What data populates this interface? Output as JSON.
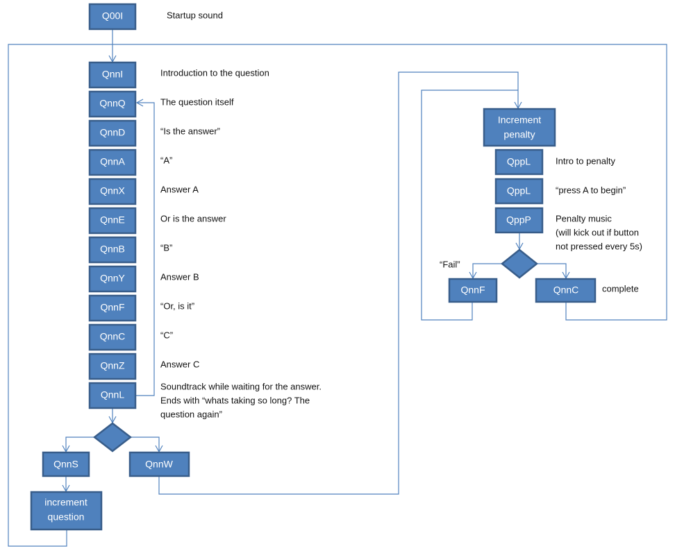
{
  "colors": {
    "node_fill": "#4f81bd",
    "node_border": "#385d8a",
    "connector": "#4f81bd"
  },
  "nodes": {
    "start": {
      "label": "Q00I",
      "note": "Startup sound"
    },
    "questions": [
      {
        "label": "QnnI",
        "note": "Introduction to the question"
      },
      {
        "label": "QnnQ",
        "note": "The question  itself"
      },
      {
        "label": "QnnD",
        "note": "“Is the answer”"
      },
      {
        "label": "QnnA",
        "note": "“A”"
      },
      {
        "label": "QnnX",
        "note": "Answer  A"
      },
      {
        "label": "QnnE",
        "note": "Or is the answer"
      },
      {
        "label": "QnnB",
        "note": "“B”"
      },
      {
        "label": "QnnY",
        "note": "Answer  B"
      },
      {
        "label": "QnnF",
        "note": "“Or, is it”"
      },
      {
        "label": "QnnC",
        "note": "“C”"
      },
      {
        "label": "QnnZ",
        "note": "Answer  C"
      },
      {
        "label": "QnnL",
        "note_lines": [
          "Soundtrack  while waiting for the answer.",
          "Ends with “whats taking so long? The",
          "question again”"
        ]
      }
    ],
    "success": {
      "label": "QnnS"
    },
    "wrong": {
      "label": "QnnW"
    },
    "increment_question": {
      "lines": [
        "increment",
        "question"
      ]
    },
    "increment_penalty": {
      "lines": [
        "Increment",
        "penalty"
      ]
    },
    "penalty_steps": [
      {
        "label": "QppL",
        "note": "Intro to penalty"
      },
      {
        "label": "QppL",
        "note": "“press A to begin”"
      },
      {
        "label": "QppP",
        "note_lines": [
          "Penalty music",
          "(will kick out  if button",
          "not pressed  every 5s)"
        ]
      }
    ],
    "penalty_fail": {
      "label": "QnnF",
      "note": "“Fail”"
    },
    "penalty_complete": {
      "label": "QnnC",
      "note": "complete"
    }
  }
}
